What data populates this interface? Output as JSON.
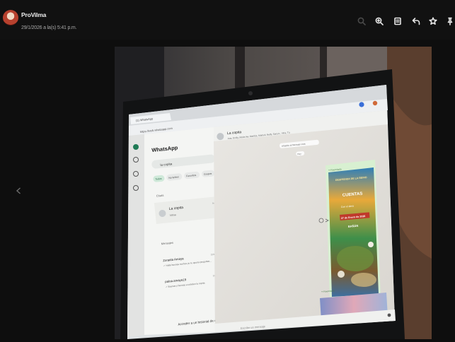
{
  "viewer": {
    "sender_name": "ProVilma",
    "timestamp": "29/1/2026 a la(s) 5:41 p.m."
  },
  "toolbar": {
    "icons": [
      "search-icon",
      "zoom-in-icon",
      "caption-icon",
      "reply-icon",
      "star-icon",
      "pin-icon"
    ]
  },
  "photo": {
    "tab_title": "(1) WhatsApp",
    "url": "https://web.whatsapp.com",
    "app_title": "WhatsApp",
    "search_text": "la copita",
    "filters": [
      "Todos",
      "No leídos",
      "Favoritos",
      "Grupos"
    ],
    "chats_label": "Chats",
    "chat_name": "La copita",
    "chat_preview": "Vilma",
    "chat_time": "hoy",
    "messages_label": "Mensajes",
    "message_rows": [
      {
        "name": "Zoraida Amaya",
        "time": "15/1/2026",
        "text": "✓ Holla buenas noches yo te quería preguntar..."
      },
      {
        "name": "paloa.amaya19",
        "time": "22/1/2026",
        "text": "✓ Buenas y buenas a ustedes la copita"
      }
    ],
    "footer_notice": "Acceder a un historial de chats más amplio en",
    "chat_header_name": "La copita",
    "chat_header_members": "Ana, Emily, Maria Aw, Maritza, Marisol, Nelly, Sara A., Vina, Tú",
    "pill_tap": "Añadido al Mensaje Lista",
    "pill_day": "Hoy",
    "forwarded_label": "↪ Reenviado",
    "poster_title": "DESPEDIDA DE LA REINO",
    "poster_headline": "CUENTAS",
    "poster_line": "Con el alma",
    "poster_date": "27 de Enero de 2026",
    "poster_place": "BAÑÁN",
    "input_placeholder": "Escribe un mensaje"
  }
}
